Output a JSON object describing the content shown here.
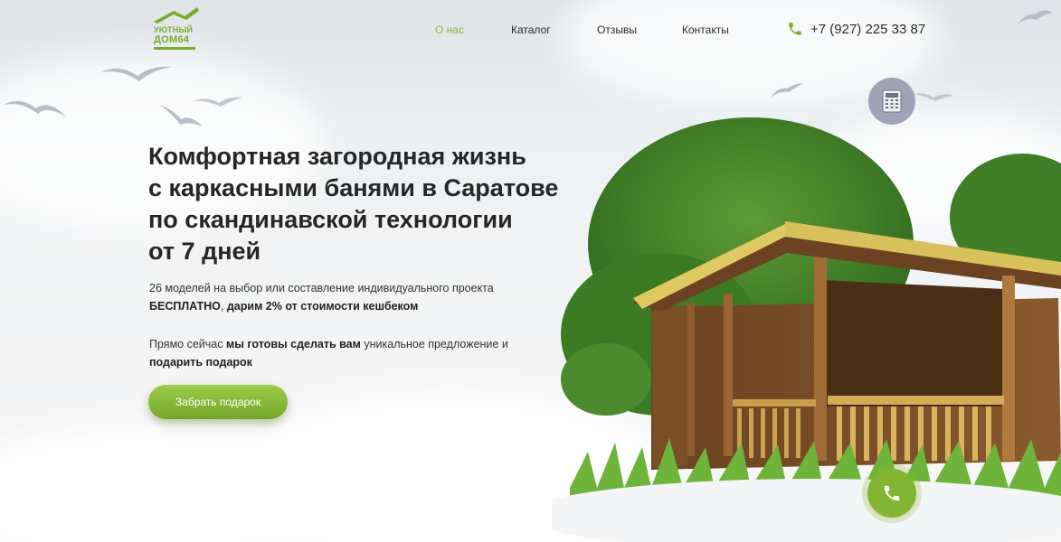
{
  "logo": {
    "line1": "УЮТНЫЙ",
    "line2": "ДОМ64"
  },
  "nav": [
    {
      "label": "О нас",
      "active": true
    },
    {
      "label": "Каталог",
      "active": false
    },
    {
      "label": "Отзывы",
      "active": false
    },
    {
      "label": "Контакты",
      "active": false
    }
  ],
  "phone": {
    "number": "+7 (927) 225 33 87",
    "icon": "phone-icon"
  },
  "hero": {
    "title_lines": [
      "Комфортная загородная жизнь",
      "с каркасными банями в Саратове",
      "по скандинавской технологии",
      "от 7 дней"
    ],
    "p1": {
      "t1": "26 моделей на выбор или составление индивидуального проекта ",
      "b1": "БЕСПЛАТНО",
      "t2": ", ",
      "b2": "дарим 2% от стоимости кешбеком"
    },
    "p2": {
      "t1": "Прямо сейчас ",
      "b1": "мы готовы сделать вам",
      "t2": " уникальное предложение и ",
      "b2": "подарить подарок"
    },
    "button": "Забрать подарок"
  },
  "widgets": {
    "calculator_icon": "calculator-icon",
    "call_icon": "phone-icon"
  },
  "colors": {
    "accent": "#86b833",
    "text": "#262626",
    "calc_bg": "#9ea4b6"
  }
}
